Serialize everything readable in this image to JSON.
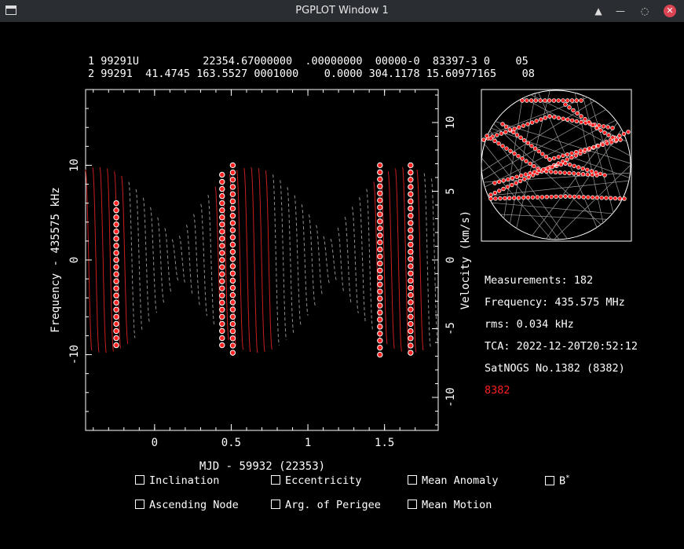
{
  "window": {
    "title": "PGPLOT Window 1"
  },
  "tle": {
    "line1": "1 99291U          22354.67000000  .00000000  00000-0  83397-3 0    05",
    "line2": "2 99291  41.4745 163.5527 0001000    0.0000 304.1178 15.60977165    08"
  },
  "info": {
    "measurements": "Measurements: 182",
    "frequency": "Frequency: 435.575 MHz",
    "rms": "rms: 0.034 kHz",
    "tca": "TCA: 2022-12-20T20:52:12",
    "station": "SatNOGS No.1382 (8382)",
    "station_id": "8382",
    "station_color": "#ff2020"
  },
  "checkboxes": {
    "inclination": "Inclination",
    "eccentricity": "Eccentricity",
    "mean_anomaly": "Mean Anomaly",
    "bstar": "B",
    "bstar_sup": "*",
    "ascending_node": "Ascending Node",
    "arg_perigee": "Arg. of Perigee",
    "mean_motion": "Mean Motion"
  },
  "chart_data": {
    "type": "scatter",
    "xlabel": "MJD - 59932 (22353)",
    "ylabel": "Frequency - 435575 kHz",
    "y2label": "Velocity (km/s)",
    "xlim": [
      -0.45,
      1.85
    ],
    "ylim": [
      -18,
      18
    ],
    "y2lim": [
      -12.4,
      12.4
    ],
    "x_ticks": [
      0,
      0.5,
      1,
      1.5
    ],
    "x_tick_labels": [
      "0",
      "0.5",
      "1",
      "1.5"
    ],
    "y_ticks": [
      -10,
      0,
      10
    ],
    "y_tick_labels": [
      "-10",
      "0",
      "10"
    ],
    "y2_ticks": [
      -10,
      -5,
      0,
      5,
      10
    ],
    "y2_tick_labels": [
      "-10",
      "-5",
      "0",
      "5",
      "10"
    ],
    "series": [
      {
        "role": "measurements",
        "color": "#ff2020",
        "points": [
          {
            "x": -0.25,
            "y_min": -9.0,
            "y_max": 6.0
          },
          {
            "x": 0.44,
            "y_min": -9.0,
            "y_max": 9.0
          },
          {
            "x": 0.51,
            "y_min": -9.8,
            "y_max": 10.0
          },
          {
            "x": 1.47,
            "y_min": -10.0,
            "y_max": 10.0
          },
          {
            "x": 1.67,
            "y_min": -9.8,
            "y_max": 10.0
          }
        ]
      }
    ],
    "model_curve": {
      "color_active": "#c81e1e",
      "color_idle": "#909090",
      "amplitude": 9.8
    }
  },
  "sky_plot": {
    "track_color": "#ff2020",
    "grid_color": "#ffffff"
  }
}
